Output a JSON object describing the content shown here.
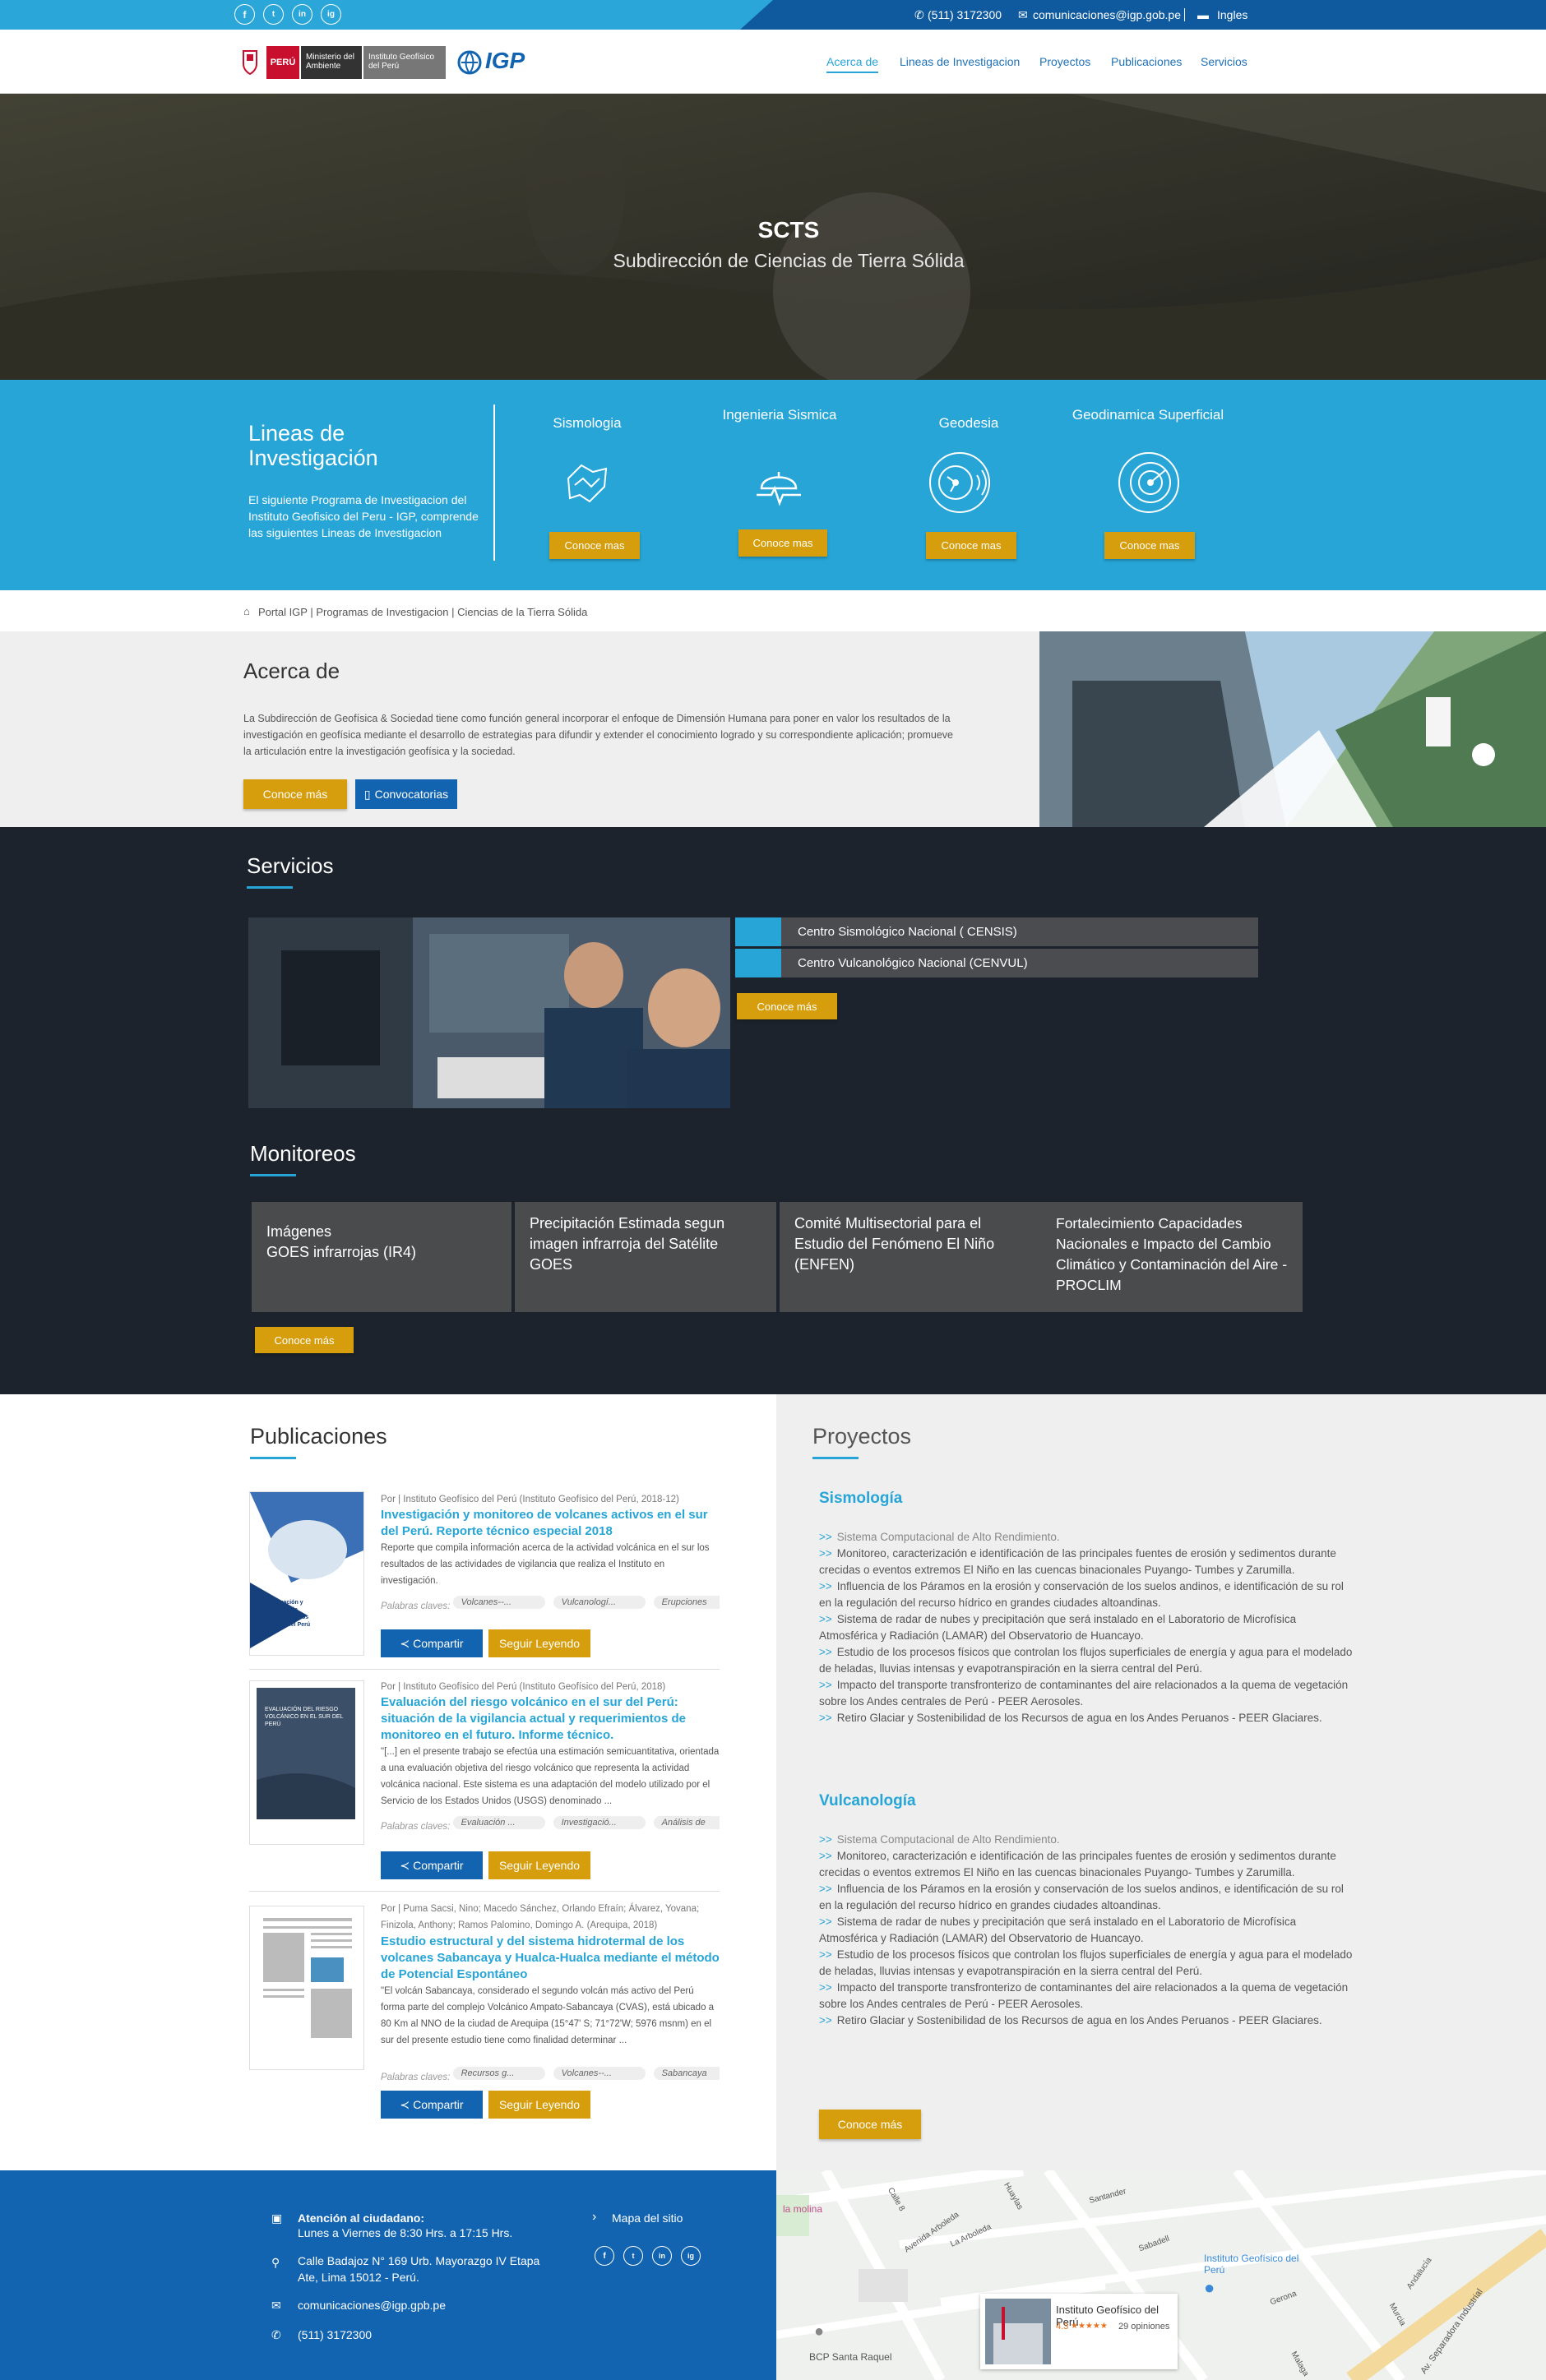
{
  "topbar": {
    "social": [
      "f",
      "t",
      "in",
      "ig"
    ],
    "phone": "(511) 3172300",
    "email": "comunicaciones@igp.gob.pe",
    "language": "Ingles"
  },
  "header": {
    "logo_peru": "PERÚ",
    "logo_ministerio": "Ministerio del Ambiente",
    "logo_instituto": "Instituto Geofísico del Perú",
    "logo_igp": "IGP",
    "nav": [
      "Acerca de",
      "Lineas de Investigacion",
      "Proyectos",
      "Publicaciones",
      "Servicios"
    ]
  },
  "hero": {
    "title": "SCTS",
    "subtitle": "Subdirección de Ciencias de Tierra Sólida"
  },
  "lineas": {
    "title": "Lineas de Investigación",
    "description": "El siguiente Programa de Investigacion del Instituto Geofisico del Peru - IGP, comprende las siguientes Lineas de Investigacion",
    "items": [
      {
        "label": "Sismologia",
        "button": "Conoce mas",
        "icon": "seismology-map-icon"
      },
      {
        "label": "Ingenieria Sismica",
        "button": "Conoce mas",
        "icon": "helmet-seismic-icon"
      },
      {
        "label": "Geodesia",
        "button": "Conoce mas",
        "icon": "satellite-signal-icon"
      },
      {
        "label": "Geodinamica Superficial",
        "button": "Conoce mas",
        "icon": "radar-icon"
      }
    ]
  },
  "breadcrumb": "Portal IGP | Programas de Investigacion | Ciencias de la Tierra Sólida",
  "acerca": {
    "title": "Acerca de",
    "text": "La Subdirección de Geofísica & Sociedad tiene como función general incorporar el enfoque de Dimensión Humana para poner en valor los resultados de la investigación en geofísica mediante el desarrollo de estrategias para difundir y extender el conocimiento logrado y su correspondiente aplicación; promueve la articulación entre la investigación geofísica y la sociedad.",
    "btn_more": "Conoce más",
    "btn_calls": "Convocatorias"
  },
  "servicios": {
    "title": "Servicios",
    "items": [
      "Centro Sismológico Nacional ( CENSIS)",
      "Centro Vulcanológico Nacional (CENVUL)"
    ],
    "button": "Conoce más"
  },
  "monitoreos": {
    "title": "Monitoreos",
    "cards": [
      "Imágenes\nGOES infrarrojas (IR4)",
      "Precipitación Estimada segun imagen infrarroja del Satélite GOES",
      "Comité Multisectorial para el Estudio del Fenómeno El Niño (ENFEN)",
      "Fortalecimiento Capacidades Nacionales e Impacto del Cambio Climático y Contaminación del Aire - PROCLIM"
    ],
    "button": "Conoce más"
  },
  "publicaciones": {
    "title": "Publicaciones",
    "keywords_label": "Palabras claves:",
    "share": "Compartir",
    "read": "Seguir Leyendo",
    "items": [
      {
        "meta": "Por | Instituto Geofísico del Perú (Instituto Geofísico del Perú, 2018-12)",
        "title": "Investigación y monitoreo de volcanes activos en el sur del Perú. Reporte técnico especial 2018",
        "text": "Reporte que compila información acerca de la actividad volcánica en el sur los resultados de las actividades de vigilancia que realiza el Instituto en investigación.",
        "tags": [
          "Volcanes--...",
          "Vulcanologí...",
          "Erupciones"
        ],
        "thumb_text": "Investigación y Monitoreo de Volcanes Activos en el Sur del Perú"
      },
      {
        "meta": "Por | Instituto Geofísico del Perú (Instituto Geofísico del Perú, 2018)",
        "title": "Evaluación del riesgo volcánico en el sur del Perú: situación de la vigilancia actual y requerimientos de monitoreo en el futuro. Informe técnico.",
        "text": "\"[...] en el presente trabajo se efectúa una estimación semicuantitativa, orientada a una evaluación objetiva del riesgo volcánico que representa la actividad volcánica nacional. Este sistema es una adaptación del modelo utilizado por el Servicio de los Estados Unidos (USGS) denominado ...",
        "tags": [
          "Evaluación ...",
          "Investigació...",
          "Análisis de"
        ],
        "thumb_text": "EVALUACIÓN DEL RIESGO VOLCÁNICO EN EL SUR DEL PERÚ"
      },
      {
        "meta": "Por | Puma Sacsi, Nino; Macedo Sánchez, Orlando Efraín; Álvarez, Yovana; Finizola, Anthony; Ramos Palomino, Domingo A. (Arequipa, 2018)",
        "title": "Estudio estructural y del sistema hidrotermal de los volcanes Sabancaya y Hualca-Hualca mediante el método de Potencial Espontáneo",
        "text": "\"El volcán Sabancaya, considerado el segundo volcán más activo del Perú forma parte del complejo Volcánico Ampato-Sabancaya (CVAS), está ubicado a 80 Km al NNO de la ciudad de Arequipa (15°47' S; 71°72'W; 5976 msnm) en el sur del presente estudio tiene como finalidad determinar ...",
        "tags": [
          "Recursos g...",
          "Volcanes--...",
          "Sabancaya"
        ],
        "thumb_text": ""
      }
    ]
  },
  "proyectos": {
    "title": "Proyectos",
    "groups": [
      {
        "name": "Sismología",
        "items": [
          "Sistema Computacional de Alto Rendimiento.",
          "Monitoreo, caracterización e identificación de las principales fuentes de erosión y sedimentos durante crecidas o eventos extremos El Niño en las cuencas binacionales Puyango- Tumbes y Zarumilla.",
          "Influencia de los Páramos en la erosión y conservación de los suelos andinos, e identificación de su rol en la regulación del recurso hídrico en grandes ciudades altoandinas.",
          "Sistema de radar de nubes y precipitación que será instalado en el Laboratorio de Microfísica Atmosférica y Radiación (LAMAR) del Observatorio de Huancayo.",
          "Estudio de los procesos físicos que controlan los flujos superficiales de energía y agua para el modelado de heladas, lluvias intensas y evapotranspiración en la sierra central del Perú.",
          "Impacto del transporte transfronterizo de contaminantes del aire relacionados a la quema de vegetación sobre los Andes centrales de Perú - PEER Aerosoles.",
          "Retiro Glaciar y Sostenibilidad de los Recursos de agua en los Andes Peruanos - PEER Glaciares."
        ]
      },
      {
        "name": "Vulcanología",
        "items": [
          "Sistema Computacional de Alto Rendimiento.",
          "Monitoreo, caracterización e identificación de las principales fuentes de erosión y sedimentos durante crecidas o eventos extremos El Niño en las cuencas binacionales Puyango- Tumbes y Zarumilla.",
          "Influencia de los Páramos en la erosión y conservación de los suelos andinos, e identificación de su rol en la regulación del recurso hídrico en grandes ciudades altoandinas.",
          "Sistema de radar de nubes y precipitación que será instalado en el Laboratorio de Microfísica Atmosférica y Radiación (LAMAR) del Observatorio de Huancayo.",
          "Estudio de los procesos físicos que controlan los flujos superficiales de energía y agua para el modelado de heladas, lluvias intensas y evapotranspiración en la sierra central del Perú.",
          "Impacto del transporte transfronterizo de contaminantes del aire relacionados a la quema de vegetación sobre los Andes centrales de Perú - PEER Aerosoles.",
          "Retiro Glaciar y Sostenibilidad de los Recursos de agua en los Andes Peruanos - PEER Glaciares."
        ]
      }
    ],
    "button": "Conoce más"
  },
  "footer": {
    "attention_title": "Atención al ciudadano:",
    "attention_hours": "Lunes a Viernes de 8:30 Hrs. a 17:15 Hrs.",
    "address": "Calle Badajoz N° 169 Urb. Mayorazgo IV Etapa Ate, Lima 15012 - Perú.",
    "email": "comunicaciones@igp.gpb.pe",
    "phone": "(511) 3172300",
    "sitemap": "Mapa del sitio",
    "social": [
      "f",
      "t",
      "in",
      "ig"
    ]
  },
  "map": {
    "labels": [
      "Santander",
      "Calle 8",
      "Avenida Arboleda",
      "La Arboleda",
      "Huaylas",
      "Sabadell",
      "Instituto Geofísico del Perú",
      "Andalucía",
      "Gerona",
      "Murcia",
      "Av. Separadora Industrial",
      "BCP Santa Raquel",
      "la molina",
      "Malaga"
    ],
    "card_title": "Instituto Geofísico del Perú",
    "card_rating": "4.3",
    "card_stars": "★★★★★",
    "card_reviews": "29 opiniones"
  },
  "colors": {
    "accent": "#26a5d6",
    "brand_blue": "#1264b0",
    "gold": "#d69d0c",
    "dark": "#1c232c"
  }
}
